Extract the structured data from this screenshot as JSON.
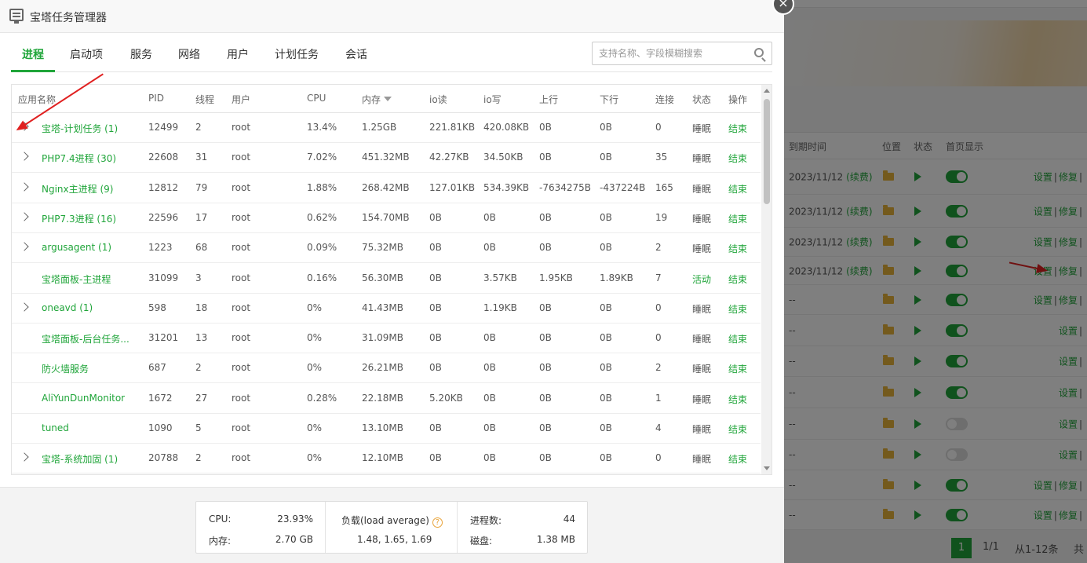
{
  "window": {
    "title": "宝塔任务管理器"
  },
  "tabs": [
    {
      "label": "进程",
      "active": true
    },
    {
      "label": "启动项"
    },
    {
      "label": "服务"
    },
    {
      "label": "网络"
    },
    {
      "label": "用户"
    },
    {
      "label": "计划任务"
    },
    {
      "label": "会话"
    }
  ],
  "search": {
    "placeholder": "支持名称、字段模糊搜索",
    "value": ""
  },
  "table": {
    "columns": [
      "应用名称",
      "PID",
      "线程",
      "用户",
      "CPU",
      "内存",
      "io读",
      "io写",
      "上行",
      "下行",
      "连接",
      "状态",
      "操作"
    ],
    "sorted_column": "内存",
    "rows": [
      {
        "name": "宝塔-计划任务 (1)",
        "expandable": true,
        "pid": "12499",
        "threads": "2",
        "user": "root",
        "cpu": "13.4%",
        "mem": "1.25GB",
        "io_read": "221.81KB",
        "io_write": "420.08KB",
        "up": "0B",
        "down": "0B",
        "conn": "0",
        "status": "睡眠",
        "action": "结束"
      },
      {
        "name": "PHP7.4进程 (30)",
        "expandable": true,
        "pid": "22608",
        "threads": "31",
        "user": "root",
        "cpu": "7.02%",
        "mem": "451.32MB",
        "io_read": "42.27KB",
        "io_write": "34.50KB",
        "up": "0B",
        "down": "0B",
        "conn": "35",
        "status": "睡眠",
        "action": "结束"
      },
      {
        "name": "Nginx主进程 (9)",
        "expandable": true,
        "pid": "12812",
        "threads": "79",
        "user": "root",
        "cpu": "1.88%",
        "mem": "268.42MB",
        "io_read": "127.01KB",
        "io_write": "534.39KB",
        "up": "-7634275B",
        "down": "-437224B",
        "conn": "165",
        "status": "睡眠",
        "action": "结束"
      },
      {
        "name": "PHP7.3进程 (16)",
        "expandable": true,
        "pid": "22596",
        "threads": "17",
        "user": "root",
        "cpu": "0.62%",
        "mem": "154.70MB",
        "io_read": "0B",
        "io_write": "0B",
        "up": "0B",
        "down": "0B",
        "conn": "19",
        "status": "睡眠",
        "action": "结束"
      },
      {
        "name": "argusagent (1)",
        "expandable": true,
        "pid": "1223",
        "threads": "68",
        "user": "root",
        "cpu": "0.09%",
        "mem": "75.32MB",
        "io_read": "0B",
        "io_write": "0B",
        "up": "0B",
        "down": "0B",
        "conn": "2",
        "status": "睡眠",
        "action": "结束"
      },
      {
        "name": "宝塔面板-主进程",
        "expandable": false,
        "pid": "31099",
        "threads": "3",
        "user": "root",
        "cpu": "0.16%",
        "mem": "56.30MB",
        "io_read": "0B",
        "io_write": "3.57KB",
        "up": "1.95KB",
        "down": "1.89KB",
        "conn": "7",
        "status": "活动",
        "action": "结束"
      },
      {
        "name": "oneavd (1)",
        "expandable": true,
        "pid": "598",
        "threads": "18",
        "user": "root",
        "cpu": "0%",
        "mem": "41.43MB",
        "io_read": "0B",
        "io_write": "1.19KB",
        "up": "0B",
        "down": "0B",
        "conn": "0",
        "status": "睡眠",
        "action": "结束"
      },
      {
        "name": "宝塔面板-后台任务...",
        "expandable": false,
        "pid": "31201",
        "threads": "13",
        "user": "root",
        "cpu": "0%",
        "mem": "31.09MB",
        "io_read": "0B",
        "io_write": "0B",
        "up": "0B",
        "down": "0B",
        "conn": "0",
        "status": "睡眠",
        "action": "结束"
      },
      {
        "name": "防火墙服务",
        "expandable": false,
        "pid": "687",
        "threads": "2",
        "user": "root",
        "cpu": "0%",
        "mem": "26.21MB",
        "io_read": "0B",
        "io_write": "0B",
        "up": "0B",
        "down": "0B",
        "conn": "2",
        "status": "睡眠",
        "action": "结束"
      },
      {
        "name": "AliYunDunMonitor",
        "expandable": false,
        "pid": "1672",
        "threads": "27",
        "user": "root",
        "cpu": "0.28%",
        "mem": "22.18MB",
        "io_read": "5.20KB",
        "io_write": "0B",
        "up": "0B",
        "down": "0B",
        "conn": "1",
        "status": "睡眠",
        "action": "结束"
      },
      {
        "name": "tuned",
        "expandable": false,
        "pid": "1090",
        "threads": "5",
        "user": "root",
        "cpu": "0%",
        "mem": "13.10MB",
        "io_read": "0B",
        "io_write": "0B",
        "up": "0B",
        "down": "0B",
        "conn": "4",
        "status": "睡眠",
        "action": "结束"
      },
      {
        "name": "宝塔-系统加固 (1)",
        "expandable": true,
        "pid": "20788",
        "threads": "2",
        "user": "root",
        "cpu": "0%",
        "mem": "12.10MB",
        "io_read": "0B",
        "io_write": "0B",
        "up": "0B",
        "down": "0B",
        "conn": "0",
        "status": "睡眠",
        "action": "结束"
      }
    ]
  },
  "summary": {
    "cpu_label": "CPU:",
    "cpu_value": "23.93%",
    "mem_label": "内存:",
    "mem_value": "2.70 GB",
    "load_label": "负载(load average)",
    "load_value": "1.48, 1.65, 1.69",
    "proc_label": "进程数:",
    "proc_value": "44",
    "disk_label": "磁盘:",
    "disk_value": "1.38 MB"
  },
  "background": {
    "columns": [
      "到期时间",
      "位置",
      "状态",
      "首页显示"
    ],
    "rows": [
      {
        "expire": "2023/11/12",
        "renew": "(续费)",
        "toggle": true,
        "ops": [
          "设置",
          "修复"
        ]
      },
      {
        "expire": "2023/11/12",
        "renew": "(续费)",
        "toggle": true,
        "ops": [
          "设置",
          "修复"
        ]
      },
      {
        "expire": "2023/11/12",
        "renew": "(续费)",
        "toggle": true,
        "ops": [
          "设置",
          "修复"
        ]
      },
      {
        "expire": "2023/11/12",
        "renew": "(续费)",
        "toggle": true,
        "ops": [
          "设置",
          "修复"
        ]
      },
      {
        "expire": "--",
        "renew": "",
        "toggle": true,
        "ops": [
          "设置",
          "修复"
        ]
      },
      {
        "expire": "--",
        "renew": "",
        "toggle": true,
        "ops": [
          "设置"
        ]
      },
      {
        "expire": "--",
        "renew": "",
        "toggle": true,
        "ops": [
          "设置"
        ]
      },
      {
        "expire": "--",
        "renew": "",
        "toggle": true,
        "ops": [
          "设置"
        ]
      },
      {
        "expire": "--",
        "renew": "",
        "toggle": false,
        "ops": [
          "设置"
        ]
      },
      {
        "expire": "--",
        "renew": "",
        "toggle": false,
        "ops": [
          "设置"
        ]
      },
      {
        "expire": "--",
        "renew": "",
        "toggle": true,
        "ops": [
          "设置",
          "修复"
        ]
      },
      {
        "expire": "--",
        "renew": "",
        "toggle": true,
        "ops": [
          "设置",
          "修复"
        ]
      }
    ],
    "pager": {
      "current": "1",
      "pages": "1/1",
      "range": "从1-12条",
      "total": "共"
    }
  },
  "colors": {
    "accent": "#20a53a",
    "annotation": "#e02020"
  }
}
